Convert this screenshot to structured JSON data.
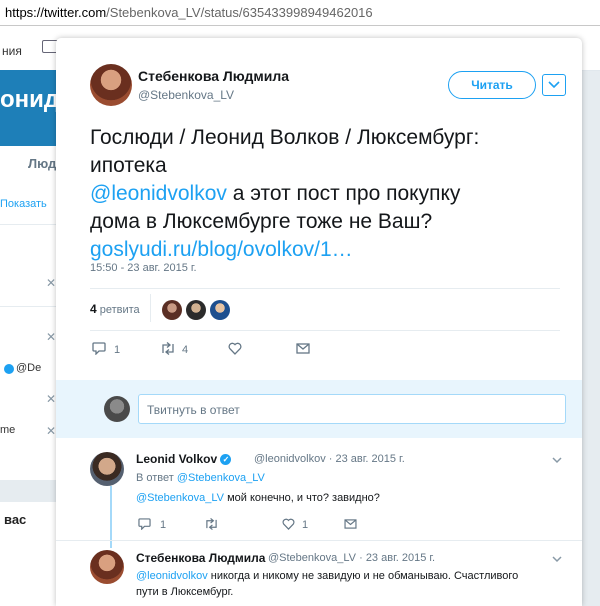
{
  "browser": {
    "url_host": "https://twitter.com",
    "url_rest": "/Stebenkova_LV/status/635433998949462016"
  },
  "background": {
    "nav_fragment": "ния",
    "banner_fragment": "онид В",
    "tab_fragment": "Люд",
    "show_link": "Показать",
    "mention_fragment": "@De",
    "me_fragment": "me",
    "section_fragment": "вас"
  },
  "tweet": {
    "author_name": "Стебенкова Людмила",
    "author_handle": "@Stebenkova_LV",
    "follow_label": "Читать",
    "text_line1": "Гослюди / Леонид Волков / Люксембург:",
    "text_line2": "ипотека",
    "mention": "@leonidvolkov",
    "text_line3_rest": " а этот пост про покупку",
    "text_line4": "дома в Люксембурге тоже не Ваш?",
    "link": "goslyudi.ru/blog/ovolkov/1…",
    "timestamp": "15:50 - 23 авг. 2015 г.",
    "retweet_count": "4",
    "retweet_label": "ретвита",
    "reply_count": "1",
    "retweet_action_count": "4"
  },
  "reply_box": {
    "placeholder": "Твитнуть в ответ"
  },
  "replies": [
    {
      "name": "Leonid Volkov",
      "handle": "@leonidvolkov",
      "date": "· 23 авг. 2015 г.",
      "in_reply_prefix": "В ответ ",
      "in_reply_handle": "@Stebenkova_LV",
      "mention": "@Stebenkova_LV",
      "text": " мой конечно, и что? завидно?",
      "reply_count": "1",
      "like_count": "1"
    },
    {
      "name": "Стебенкова Людмила",
      "handle": "@Stebenkova_LV",
      "date": "· 23 авг. 2015 г.",
      "mention": "@leonidvolkov",
      "text_line1": " никогда и никому не завидую и не обманываю. Счастливого",
      "text_line2": "пути в Люксембург."
    }
  ],
  "colors": {
    "accent": "#1da1f2",
    "reply_bg": "#e8f5fd",
    "text": "#14171a",
    "muted": "#657786"
  },
  "icons": [
    "chevron-down-icon",
    "reply-icon",
    "retweet-icon",
    "like-icon",
    "direct-message-icon",
    "verified-icon",
    "mail-icon"
  ]
}
